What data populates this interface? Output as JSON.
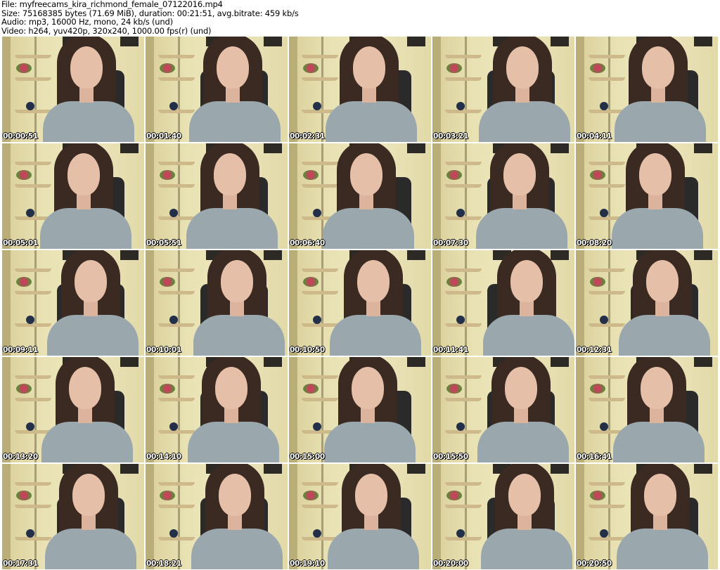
{
  "header": {
    "file": "File: myfreecams_kira_richmond_female_07122016.mp4",
    "size": "Size: 75168385 bytes (71.69 MiB), duration: 00:21:51, avg.bitrate: 459 kb/s",
    "audio": "Audio: mp3, 16000 Hz, mono, 24 kb/s (und)",
    "video": "Video: h264, yuv420p, 320x240, 1000.00 fps(r) (und)"
  },
  "thumbnails": [
    {
      "timestamp": "00:00:51"
    },
    {
      "timestamp": "00:01:40"
    },
    {
      "timestamp": "00:02:31"
    },
    {
      "timestamp": "00:03:21"
    },
    {
      "timestamp": "00:04:11"
    },
    {
      "timestamp": "00:05:01"
    },
    {
      "timestamp": "00:05:51"
    },
    {
      "timestamp": "00:06:40"
    },
    {
      "timestamp": "00:07:30"
    },
    {
      "timestamp": "00:08:20"
    },
    {
      "timestamp": "00:09:11"
    },
    {
      "timestamp": "00:10:01"
    },
    {
      "timestamp": "00:10:50"
    },
    {
      "timestamp": "00:11:41"
    },
    {
      "timestamp": "00:12:31"
    },
    {
      "timestamp": "00:13:20"
    },
    {
      "timestamp": "00:14:10"
    },
    {
      "timestamp": "00:15:00"
    },
    {
      "timestamp": "00:15:50"
    },
    {
      "timestamp": "00:16:41"
    },
    {
      "timestamp": "00:17:31"
    },
    {
      "timestamp": "00:18:21"
    },
    {
      "timestamp": "00:19:10"
    },
    {
      "timestamp": "00:20:00"
    },
    {
      "timestamp": "00:20:50"
    }
  ]
}
